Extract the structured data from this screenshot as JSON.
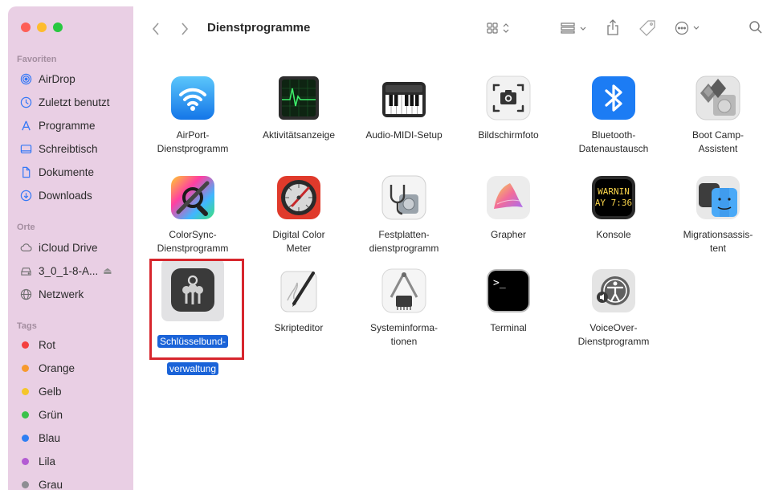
{
  "window": {
    "title": "Dienstprogramme"
  },
  "sidebar": {
    "favorites_header": "Favoriten",
    "favorites": [
      {
        "label": "AirDrop",
        "icon": "airdrop-icon"
      },
      {
        "label": "Zuletzt benutzt",
        "icon": "clock-icon"
      },
      {
        "label": "Programme",
        "icon": "applications-icon"
      },
      {
        "label": "Schreibtisch",
        "icon": "desktop-icon"
      },
      {
        "label": "Dokumente",
        "icon": "document-icon"
      },
      {
        "label": "Downloads",
        "icon": "download-icon"
      }
    ],
    "locations_header": "Orte",
    "locations": [
      {
        "label": "iCloud Drive",
        "icon": "cloud-icon"
      },
      {
        "label": "3_0_1-8-A...",
        "icon": "drive-icon",
        "eject": "⏏"
      },
      {
        "label": "Netzwerk",
        "icon": "network-icon"
      }
    ],
    "tags_header": "Tags",
    "tags": [
      {
        "label": "Rot",
        "color": "#f43f3f"
      },
      {
        "label": "Orange",
        "color": "#f79a2e"
      },
      {
        "label": "Gelb",
        "color": "#f5c62a"
      },
      {
        "label": "Grün",
        "color": "#3bc24b"
      },
      {
        "label": "Blau",
        "color": "#2f7ff3"
      },
      {
        "label": "Lila",
        "color": "#b35bd3"
      },
      {
        "label": "Grau",
        "color": "#8e8e93"
      }
    ]
  },
  "toolbar": {
    "back_icon": "chevron-left-icon",
    "forward_icon": "chevron-right-icon",
    "view_icon": "grid-view-icon",
    "group_icon": "group-icon",
    "share_icon": "share-icon",
    "tag_icon": "tag-icon",
    "more_icon": "ellipsis-circle-icon",
    "search_icon": "search-icon"
  },
  "apps": [
    {
      "label": "AirPort-\nDienstprogramm"
    },
    {
      "label": "Aktivitätsanzeige"
    },
    {
      "label": "Audio-MIDI-Setup"
    },
    {
      "label": "Bildschirmfoto"
    },
    {
      "label": "Bluetooth-\nDatenaustausch"
    },
    {
      "label": "Boot Camp-\nAssistent"
    },
    {
      "label": "ColorSync-\nDienstprogramm"
    },
    {
      "label": "Digital Color\nMeter"
    },
    {
      "label": "Festplatten-\ndienstprogramm"
    },
    {
      "label": "Grapher"
    },
    {
      "label": "Konsole",
      "icon_text_1": "WARNIN",
      "icon_text_2": "AY 7:36"
    },
    {
      "label": "Migrationsassis-\ntent"
    },
    {
      "label_line1": "Schlüsselbund-",
      "label_line2": "verwaltung",
      "selected": true
    },
    {
      "label": "Skripteditor"
    },
    {
      "label": "Systeminforma-\ntionen"
    },
    {
      "label": "Terminal",
      "icon_text": ">_"
    },
    {
      "label": "VoiceOver-\nDienstprogramm"
    }
  ],
  "colors": {
    "sidebar_bg": "#e9cfe4",
    "selection": "#1a63d8",
    "highlight_box": "#d7262d"
  }
}
